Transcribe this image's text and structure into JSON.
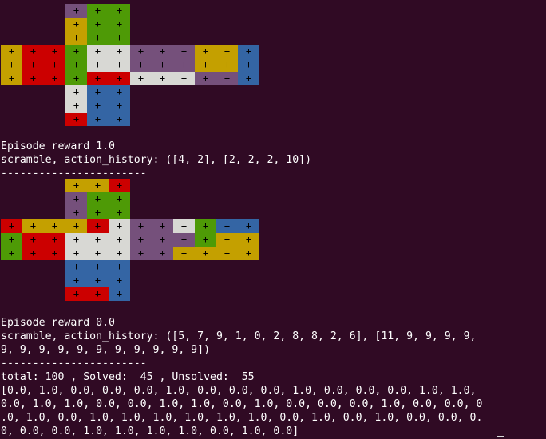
{
  "palette": {
    "W": "#d8d8d4",
    "R": "#cc0000",
    "G": "#4e9a06",
    "Y": "#c4a000",
    "P": "#75507b",
    "B": "#3465a4"
  },
  "cubes": [
    {
      "top": [
        [
          "P",
          "G",
          "G"
        ],
        [
          "Y",
          "G",
          "G"
        ],
        [
          "Y",
          "G",
          "G"
        ]
      ],
      "left": [
        [
          "Y",
          "R",
          "R"
        ],
        [
          "Y",
          "R",
          "R"
        ],
        [
          "Y",
          "R",
          "R"
        ]
      ],
      "front": [
        [
          "G",
          "W",
          "W"
        ],
        [
          "G",
          "W",
          "W"
        ],
        [
          "G",
          "R",
          "R"
        ]
      ],
      "right": [
        [
          "P",
          "P",
          "P"
        ],
        [
          "P",
          "P",
          "P"
        ],
        [
          "W",
          "W",
          "W"
        ]
      ],
      "back": [
        [
          "Y",
          "Y",
          "B"
        ],
        [
          "Y",
          "Y",
          "B"
        ],
        [
          "P",
          "P",
          "B"
        ]
      ],
      "bottom": [
        [
          "W",
          "B",
          "B"
        ],
        [
          "W",
          "B",
          "B"
        ],
        [
          "R",
          "B",
          "B"
        ]
      ]
    },
    {
      "top": [
        [
          "Y",
          "Y",
          "R"
        ],
        [
          "P",
          "G",
          "G"
        ],
        [
          "P",
          "G",
          "G"
        ]
      ],
      "left": [
        [
          "R",
          "Y",
          "Y"
        ],
        [
          "G",
          "R",
          "R"
        ],
        [
          "G",
          "R",
          "R"
        ]
      ],
      "front": [
        [
          "Y",
          "R",
          "W"
        ],
        [
          "W",
          "W",
          "W"
        ],
        [
          "W",
          "W",
          "W"
        ]
      ],
      "right": [
        [
          "P",
          "P",
          "W"
        ],
        [
          "P",
          "P",
          "P"
        ],
        [
          "P",
          "P",
          "Y"
        ]
      ],
      "back": [
        [
          "G",
          "B",
          "B"
        ],
        [
          "G",
          "Y",
          "Y"
        ],
        [
          "Y",
          "Y",
          "Y"
        ]
      ],
      "bottom": [
        [
          "B",
          "B",
          "B"
        ],
        [
          "B",
          "B",
          "B"
        ],
        [
          "R",
          "R",
          "B"
        ]
      ]
    }
  ],
  "terminal_lines": [
    "Episode reward 1.0",
    "scramble, action_history: ([4, 2], [2, 2, 2, 10])",
    "-----------------------",
    "Episode reward 0.0",
    "scramble, action_history: ([5, 7, 9, 1, 0, 2, 8, 8, 2, 6], [11, 9, 9, 9, 9,",
    "9, 9, 9, 9, 9, 9, 9, 9, 9, 9, 9])",
    "-----------------------",
    "total: 100 , Solved:  45 , Unsolved:  55",
    "[0.0, 1.0, 0.0, 0.0, 0.0, 1.0, 0.0, 0.0, 0.0, 1.0, 0.0, 0.0, 0.0, 1.0, 1.0,",
    "0.0, 1.0, 1.0, 0.0, 0.0, 1.0, 1.0, 0.0, 1.0, 0.0, 0.0, 0.0, 1.0, 0.0, 0.0, 0",
    ".0, 1.0, 0.0, 1.0, 1.0, 1.0, 1.0, 1.0, 1.0, 0.0, 1.0, 0.0, 1.0, 0.0, 0.0, 0.",
    "0, 0.0, 0.0, 1.0, 1.0, 1.0, 1.0, 0.0, 1.0, 0.0]"
  ]
}
